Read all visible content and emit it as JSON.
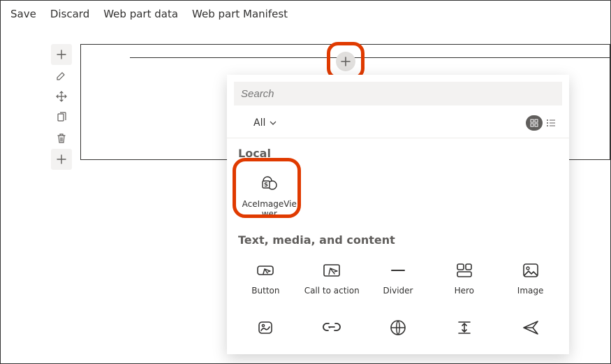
{
  "topbar": {
    "save": "Save",
    "discard": "Discard",
    "webpartData": "Web part data",
    "webpartManifest": "Web part Manifest"
  },
  "picker": {
    "searchPlaceholder": "Search",
    "filter": "All",
    "groups": {
      "local": "Local",
      "textMedia": "Text, media, and content"
    },
    "localItems": [
      {
        "label": "AceImageViewer"
      }
    ],
    "textMediaItems": [
      {
        "label": "Button"
      },
      {
        "label": "Call to action"
      },
      {
        "label": "Divider"
      },
      {
        "label": "Hero"
      },
      {
        "label": "Image"
      }
    ]
  }
}
